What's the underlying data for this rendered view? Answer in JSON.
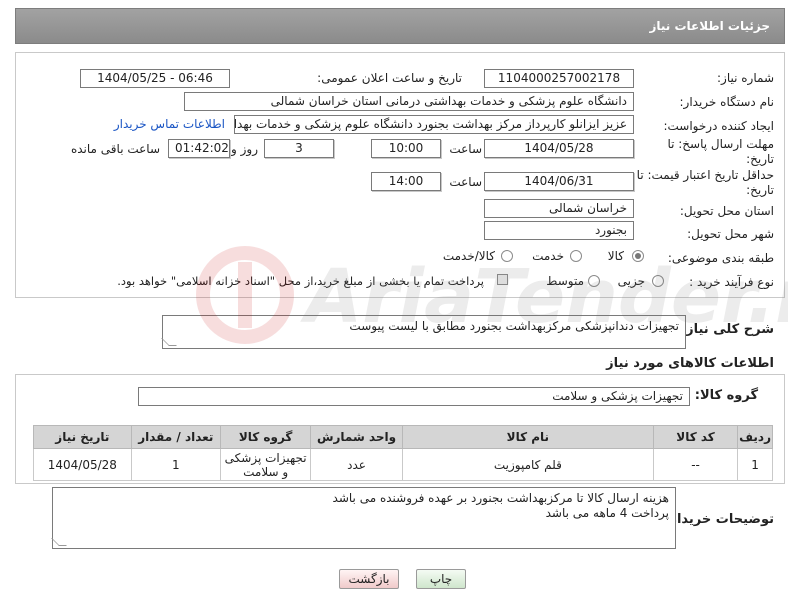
{
  "header": {
    "title": "جزئیات اطلاعات نیاز"
  },
  "form": {
    "need_number_label": "شماره نیاز:",
    "need_number_value": "1104000257002178",
    "announce_label": "تاریخ و ساعت اعلان عمومی:",
    "announce_value": "1404/05/25 - 06:46",
    "buyer_org_label": "نام دستگاه خریدار:",
    "buyer_org_value": "دانشگاه علوم پزشکی و خدمات بهداشتی درمانی استان خراسان شمالی",
    "requester_label": "ایجاد کننده درخواست:",
    "requester_value": "عزیز ایزانلو کارپرداز مرکز بهداشت بجنورد دانشگاه علوم پزشکی و خدمات بهداشتی",
    "contact_link": "اطلاعات تماس خریدار",
    "deadline_label": "مهلت ارسال پاسخ: تا تاریخ:",
    "deadline_date": "1404/05/28",
    "time_label": "ساعت",
    "deadline_time": "10:00",
    "days_value": "3",
    "days_label": "روز و",
    "remaining_value": "01:42:02",
    "remaining_label": "ساعت باقی مانده",
    "price_validity_label": "حداقل تاریخ اعتبار قیمت: تا تاریخ:",
    "price_validity_date": "1404/06/31",
    "price_validity_time": "14:00",
    "province_label": "استان محل تحویل:",
    "province_value": "خراسان شمالی",
    "city_label": "شهر محل تحویل:",
    "city_value": "بجنورد",
    "category_label": "طبقه بندی موضوعی:",
    "category_options": [
      "کالا",
      "خدمت",
      "کالا/خدمت"
    ],
    "process_label": "نوع فرآیند خرید :",
    "process_options": [
      "جزیی",
      "متوسط"
    ],
    "payment_note": "پرداخت تمام یا بخشی از مبلغ خرید،از محل \"اسناد خزانه اسلامی\" خواهد بود."
  },
  "summary": {
    "label": "شرح کلی نیاز:",
    "value": "تجهیزات دندانپزشکی مرکزبهداشت بجنورد مطابق با لیست پیوست"
  },
  "goods": {
    "section_title": "اطلاعات کالاهای مورد نیاز",
    "group_label": "گروه کالا:",
    "group_value": "تجهیزات پزشکی و سلامت",
    "columns": [
      "ردیف",
      "کد کالا",
      "نام کالا",
      "واحد شمارش",
      "گروه کالا",
      "تعداد / مقدار",
      "تاریخ نیاز"
    ],
    "rows": [
      {
        "row": "1",
        "code": "--",
        "name": "قلم کامپوزیت",
        "unit": "عدد",
        "group": "تجهیزات پزشکی و سلامت",
        "qty": "1",
        "date": "1404/05/28"
      }
    ]
  },
  "buyer_notes": {
    "label": "توضیحات خریدار:",
    "line1": "هزینه ارسال کالا تا مرکزبهداشت بجنورد بر عهده فروشنده می باشد",
    "line2": "پرداخت 4 ماهه می باشد"
  },
  "buttons": {
    "print": "چاپ",
    "back": "بازگشت"
  },
  "watermark": {
    "brand": "AriaTender.net"
  }
}
